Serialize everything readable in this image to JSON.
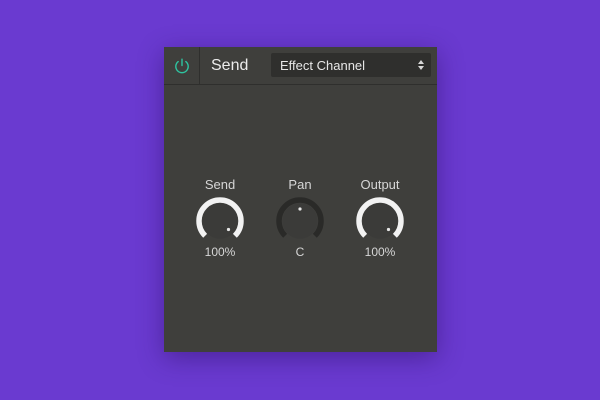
{
  "device": {
    "title": "Send",
    "power_icon": "power-icon",
    "power_on": true,
    "channel_select": {
      "value": "Effect Channel",
      "arrows_icon": "updown-arrows-icon"
    },
    "knobs": [
      {
        "id": "send",
        "label": "Send",
        "value": "100%",
        "level": 1.0,
        "bipolar": false
      },
      {
        "id": "pan",
        "label": "Pan",
        "value": "C",
        "level": 0.5,
        "bipolar": true
      },
      {
        "id": "output",
        "label": "Output",
        "value": "100%",
        "level": 1.0,
        "bipolar": false
      }
    ]
  },
  "colors": {
    "background": "#6a3ad0",
    "panel": "#3f3f3c",
    "accent_power": "#2ec4a0",
    "knob_arc": "#f2f2f2",
    "knob_track": "#2a2a28"
  }
}
